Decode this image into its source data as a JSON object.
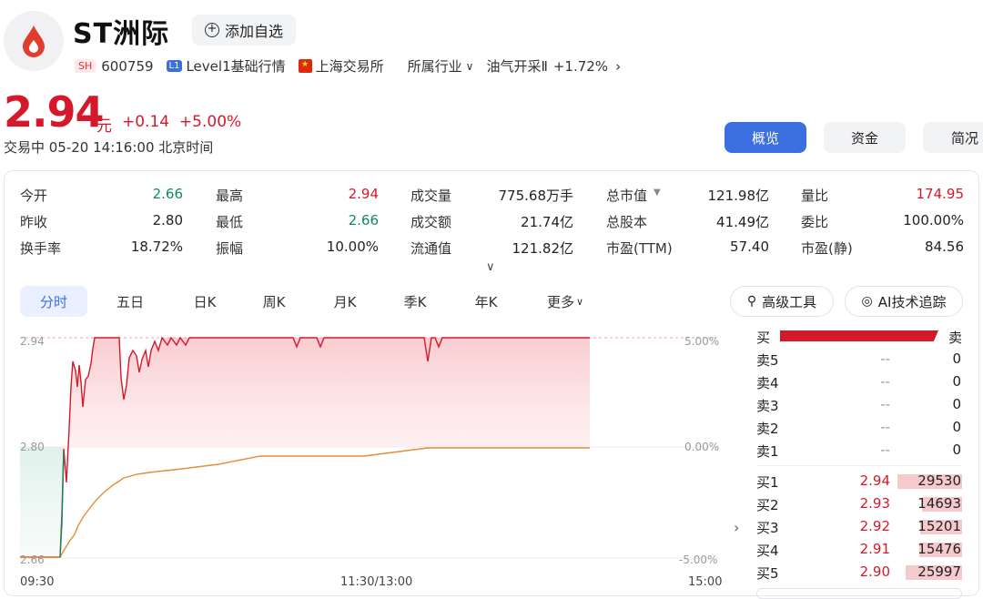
{
  "header": {
    "name": "ST洲际",
    "add_label": "添加自选",
    "exchange_tag": "SH",
    "code": "600759",
    "level_tag": "L1",
    "level": "Level1基础行情",
    "market": "上海交易所",
    "industry_label": "所属行业",
    "industry": "油气开采Ⅱ",
    "industry_change": "+1.72%"
  },
  "quote": {
    "price": "2.94",
    "unit": "元",
    "change": "+0.14",
    "change_pct": "+5.00%",
    "status": "交易中 05-20 14:16:00 北京时间"
  },
  "tabs": [
    {
      "label": "概览",
      "active": true
    },
    {
      "label": "资金",
      "active": false
    },
    {
      "label": "简况",
      "active": false
    }
  ],
  "stats": [
    [
      {
        "label": "今开",
        "value": "2.66",
        "color": "green"
      },
      {
        "label": "最高",
        "value": "2.94",
        "color": "red"
      },
      {
        "label": "成交量",
        "value": "775.68万手",
        "color": ""
      },
      {
        "label": "总市值",
        "value": "121.98亿",
        "color": ""
      },
      {
        "label": "量比",
        "value": "174.95",
        "color": "red"
      }
    ],
    [
      {
        "label": "昨收",
        "value": "2.80",
        "color": ""
      },
      {
        "label": "最低",
        "value": "2.66",
        "color": "green"
      },
      {
        "label": "成交额",
        "value": "21.74亿",
        "color": ""
      },
      {
        "label": "总股本",
        "value": "41.49亿",
        "color": ""
      },
      {
        "label": "委比",
        "value": "100.00%",
        "color": ""
      }
    ],
    [
      {
        "label": "换手率",
        "value": "18.72%",
        "color": ""
      },
      {
        "label": "振幅",
        "value": "10.00%",
        "color": ""
      },
      {
        "label": "流通值",
        "value": "121.82亿",
        "color": ""
      },
      {
        "label": "市盈(TTM)",
        "value": "57.40",
        "color": ""
      },
      {
        "label": "市盈(静)",
        "value": "84.56",
        "color": ""
      }
    ]
  ],
  "ktabs": [
    "分时",
    "五日",
    "日K",
    "周K",
    "月K",
    "季K",
    "年K",
    "更多"
  ],
  "tools": {
    "advanced": "高级工具",
    "ai": "AI技术追踪"
  },
  "chart": {
    "y_top": "2.94",
    "y_mid": "2.80",
    "y_bot": "2.66",
    "pct_top": "5.00%",
    "pct_mid": "0.00%",
    "pct_bot": "-5.00%",
    "x_start": "09:30",
    "x_mid": "11:30/13:00",
    "x_end": "15:00"
  },
  "orderbook": {
    "buy_label": "买",
    "sell_label": "卖",
    "asks": [
      {
        "label": "卖5",
        "price": "--",
        "vol": "0"
      },
      {
        "label": "卖4",
        "price": "--",
        "vol": "0"
      },
      {
        "label": "卖3",
        "price": "--",
        "vol": "0"
      },
      {
        "label": "卖2",
        "price": "--",
        "vol": "0"
      },
      {
        "label": "卖1",
        "price": "--",
        "vol": "0"
      }
    ],
    "bids": [
      {
        "label": "买1",
        "price": "2.94",
        "vol": "29530"
      },
      {
        "label": "买2",
        "price": "2.93",
        "vol": "14693"
      },
      {
        "label": "买3",
        "price": "2.92",
        "vol": "15201"
      },
      {
        "label": "买4",
        "price": "2.91",
        "vol": "15476"
      },
      {
        "label": "买5",
        "price": "2.90",
        "vol": "25997"
      }
    ]
  },
  "colors": {
    "up": "#d5192b",
    "down": "#0f8a5f",
    "accent": "#3b6fe0",
    "avg": "#e88a3a"
  }
}
